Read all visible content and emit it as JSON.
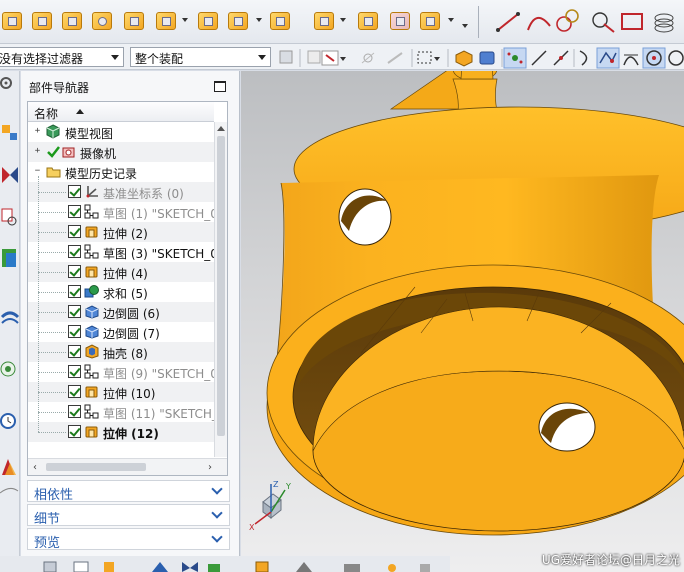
{
  "filter_bar": {
    "selection_filter": "没有选择过滤器",
    "assembly_scope": "整个装配"
  },
  "navigator": {
    "title": "部件导航器",
    "column_header": "名称",
    "nodes": [
      {
        "label": "模型视图",
        "icon": "model-views-icon",
        "level": 0,
        "expander": "+",
        "checked": false,
        "style": "normal"
      },
      {
        "label": "摄像机",
        "icon": "camera-icon",
        "level": 0,
        "expander": "+",
        "checked": false,
        "style": "normal"
      },
      {
        "label": "模型历史记录",
        "icon": "folder-icon",
        "level": 0,
        "expander": "−",
        "checked": false,
        "style": "normal"
      },
      {
        "label": "基准坐标系 (0)",
        "icon": "datum-csys-icon",
        "level": 1,
        "checked": true,
        "style": "dim"
      },
      {
        "label": "草图 (1) \"SKETCH_0",
        "icon": "sketch-icon",
        "level": 1,
        "checked": true,
        "style": "dim"
      },
      {
        "label": "拉伸 (2)",
        "icon": "extrude-icon",
        "level": 1,
        "checked": true,
        "style": "normal"
      },
      {
        "label": "草图 (3) \"SKETCH_0",
        "icon": "sketch-icon",
        "level": 1,
        "checked": true,
        "style": "normal"
      },
      {
        "label": "拉伸 (4)",
        "icon": "extrude-icon",
        "level": 1,
        "checked": true,
        "style": "normal"
      },
      {
        "label": "求和 (5)",
        "icon": "unite-icon",
        "level": 1,
        "checked": true,
        "style": "normal"
      },
      {
        "label": "边倒圆 (6)",
        "icon": "edge-blend-icon",
        "level": 1,
        "checked": true,
        "style": "normal"
      },
      {
        "label": "边倒圆 (7)",
        "icon": "edge-blend-icon",
        "level": 1,
        "checked": true,
        "style": "normal"
      },
      {
        "label": "抽壳 (8)",
        "icon": "shell-icon",
        "level": 1,
        "checked": true,
        "style": "normal"
      },
      {
        "label": "草图 (9) \"SKETCH_0",
        "icon": "sketch-icon",
        "level": 1,
        "checked": true,
        "style": "dim"
      },
      {
        "label": "拉伸 (10)",
        "icon": "extrude-icon",
        "level": 1,
        "checked": true,
        "style": "normal"
      },
      {
        "label": "草图 (11) \"SKETCH_",
        "icon": "sketch-icon",
        "level": 1,
        "checked": true,
        "style": "dim"
      },
      {
        "label": "拉伸 (12)",
        "icon": "extrude-icon",
        "level": 1,
        "checked": true,
        "style": "bold"
      }
    ],
    "panels": [
      "相依性",
      "细节",
      "预览"
    ]
  },
  "viewport": {
    "model_color": "#f7a81b",
    "background_top": "#bcbec1",
    "background_bottom": "#eeeeef",
    "triad_axes": [
      "X",
      "Y",
      "Z"
    ],
    "watermark": "UG爱好者论坛@日月之光"
  },
  "colors": {
    "accent_blue": "#2a5fae",
    "feature_orange": "#f3a623",
    "check_green": "#1c7a1c"
  }
}
